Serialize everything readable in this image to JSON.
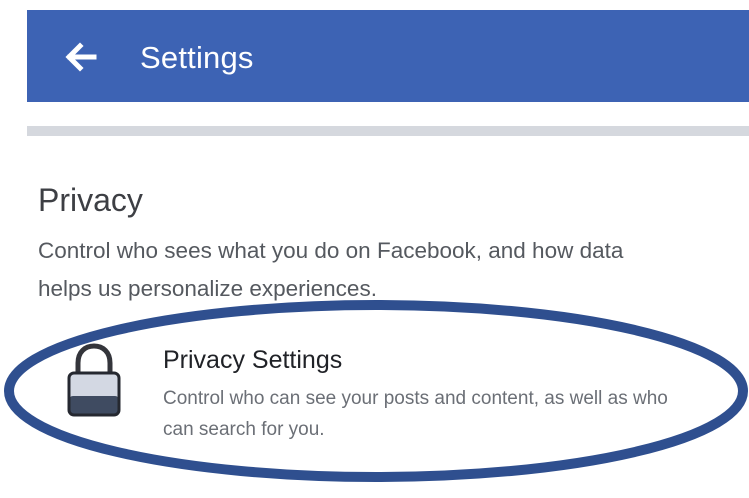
{
  "header": {
    "title": "Settings",
    "back_icon": "arrow-left-icon"
  },
  "privacy_section": {
    "title": "Privacy",
    "description": "Control who sees what you do on Facebook, and how data helps us personalize experiences."
  },
  "privacy_settings_item": {
    "icon": "lock-icon",
    "title": "Privacy Settings",
    "description": "Control who can see your posts and content, as well as who can search for you."
  },
  "colors": {
    "header_blue": "#3d63b4",
    "highlight_oval": "#2f4f8f"
  }
}
